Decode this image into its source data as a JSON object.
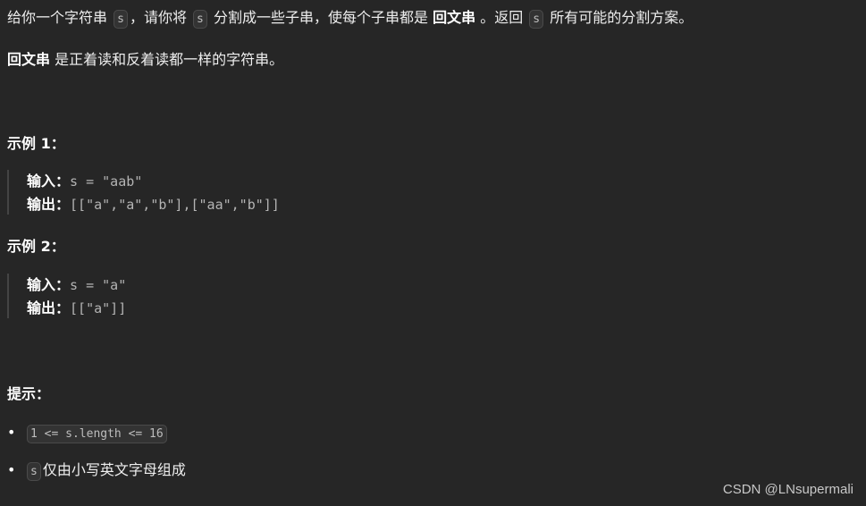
{
  "problem": {
    "description": {
      "part1": "给你一个字符串",
      "code1": "s",
      "part2": "，请你将",
      "code2": "s",
      "part3": "分割成一些子串，使每个子串都是",
      "bold": "回文串",
      "part4": "。返回",
      "code3": "s",
      "part5": "所有可能的分割方案。"
    },
    "definition": {
      "bold": "回文串",
      "rest": "是正着读和反着读都一样的字符串。"
    }
  },
  "examples": [
    {
      "title": "示例 1：",
      "input_label": "输入：",
      "input_value": "s = \"aab\"",
      "output_label": "输出：",
      "output_value": "[[\"a\",\"a\",\"b\"],[\"aa\",\"b\"]]"
    },
    {
      "title": "示例 2：",
      "input_label": "输入：",
      "input_value": "s = \"a\"",
      "output_label": "输出：",
      "output_value": "[[\"a\"]]"
    }
  ],
  "tips": {
    "title": "提示：",
    "items": [
      {
        "code": "1 <= s.length <= 16",
        "text": ""
      },
      {
        "code": "s",
        "text": "仅由小写英文字母组成"
      }
    ],
    "bullet": "•"
  },
  "watermark": "CSDN @LNsupermali"
}
